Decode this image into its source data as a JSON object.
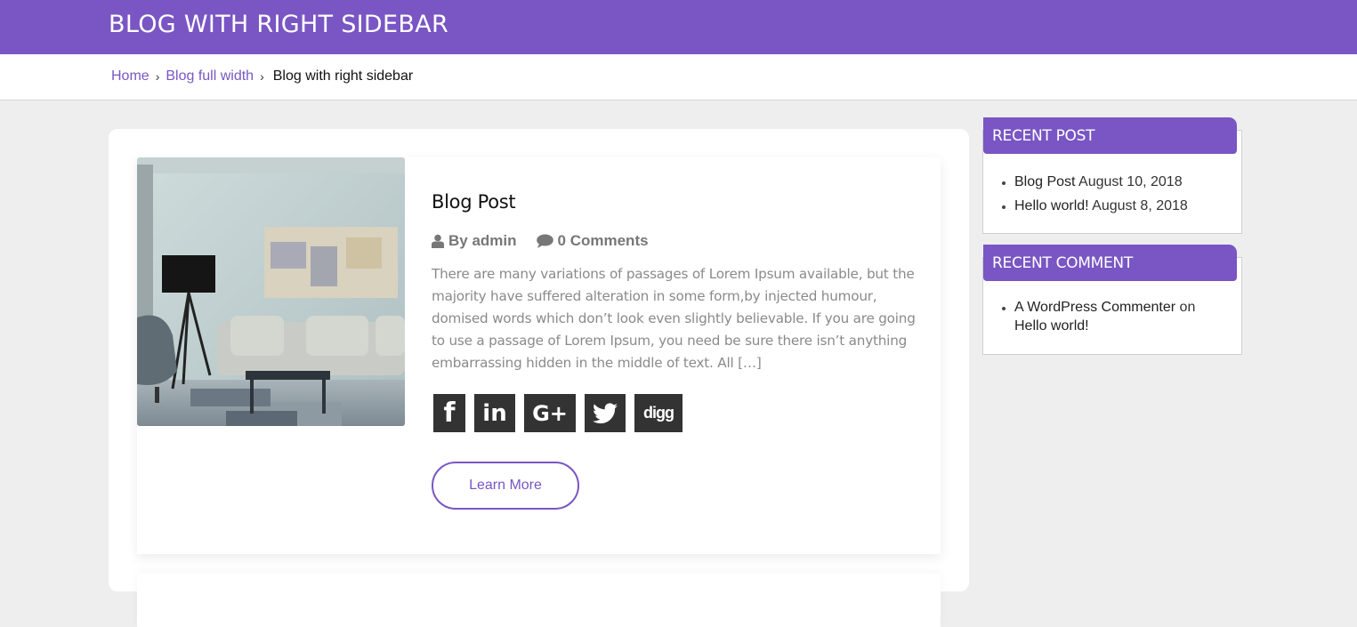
{
  "header": {
    "title": "BLOG WITH RIGHT SIDEBAR"
  },
  "breadcrumb": {
    "items": [
      {
        "label": "Home"
      },
      {
        "label": "Blog full width"
      }
    ],
    "separator": "›",
    "current": "Blog with right sidebar"
  },
  "post": {
    "title": "Blog Post",
    "author": "By admin",
    "comments": "0 Comments",
    "excerpt": "There are many variations of passages of Lorem Ipsum available, but the majority have suffered alteration in some form,by injected humour, domised words which don’t look even slightly believable. If you are going to use a passage of Lorem Ipsum, you need be sure there isn’t anything embarrassing hidden in the middle of text. All […]",
    "image_alt": "Living room interior with sofa, floor lamp and abstract painting",
    "social": [
      {
        "name": "facebook",
        "glyph": "f"
      },
      {
        "name": "linkedin",
        "glyph": "in"
      },
      {
        "name": "google-plus",
        "glyph": "G+"
      },
      {
        "name": "twitter",
        "glyph": ""
      },
      {
        "name": "digg",
        "glyph": "digg"
      }
    ],
    "learn_more": "Learn More"
  },
  "sidebar": {
    "recent_post": {
      "title": "RECENT POST",
      "items": [
        {
          "link": "Blog Post",
          "date": "August 10, 2018"
        },
        {
          "link": "Hello world!",
          "date": "August 8, 2018"
        }
      ]
    },
    "recent_comment": {
      "title": "RECENT COMMENT",
      "items": [
        {
          "author": "A WordPress Commenter",
          "on": "on",
          "post": "Hello world!"
        }
      ]
    }
  },
  "colors": {
    "accent": "#7956c3",
    "social_bg": "#333333",
    "page_bg": "#eeeeee"
  }
}
